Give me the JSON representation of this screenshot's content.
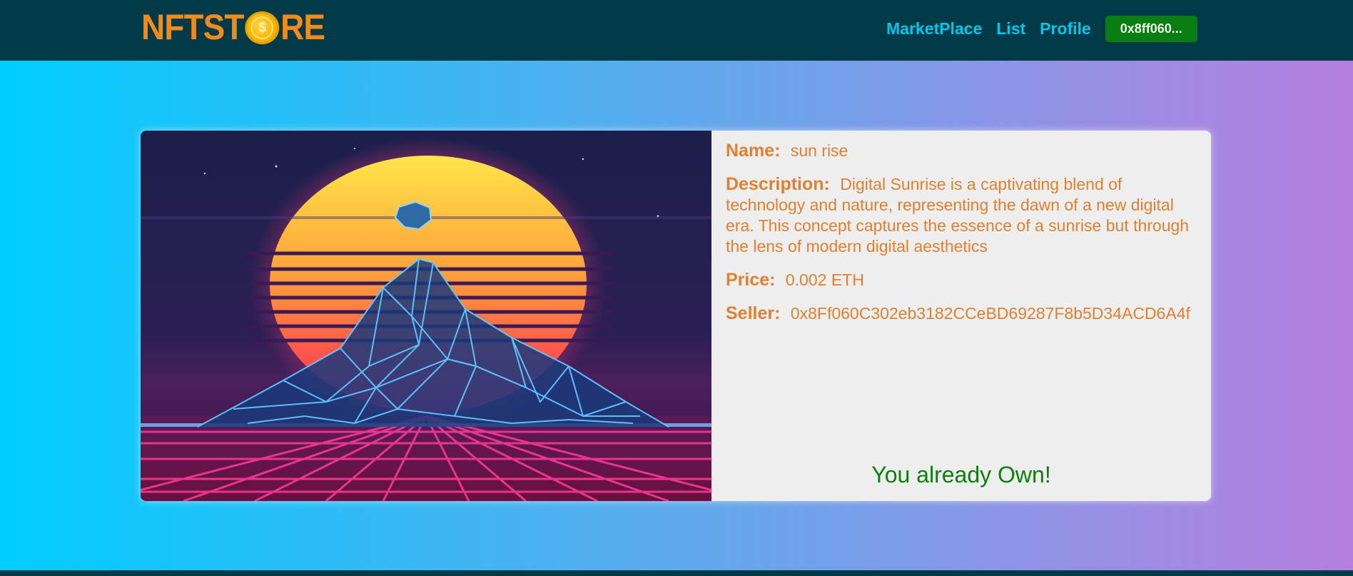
{
  "brand": {
    "logo_left": "NFTST",
    "logo_right": "RE",
    "coin_symbol": "$"
  },
  "nav": {
    "links": [
      "MarketPlace",
      "List",
      "Profile"
    ],
    "wallet_button": "0x8ff060..."
  },
  "nft": {
    "image_icon": "synthwave-sunrise-mountain-image",
    "name_label": "Name:",
    "name": "sun rise",
    "description_label": "Description:",
    "description": "Digital Sunrise is a captivating blend of technology and nature, representing the dawn of a new digital era. This concept captures the essence of a sunrise but through the lens of modern digital aesthetics",
    "price_label": "Price:",
    "price": "0.002 ETH",
    "seller_label": "Seller:",
    "seller": "0x8Ff060C302eb3182CCeBD69287F8b5D34ACD6A4f",
    "ownership_status": "You already Own!"
  },
  "colors": {
    "navbar": "#003a47",
    "accent_orange": "#f28a1c",
    "nav_link": "#00c7ec",
    "wallet_green": "#0a7d12",
    "owned_green": "#0d7f0d"
  }
}
